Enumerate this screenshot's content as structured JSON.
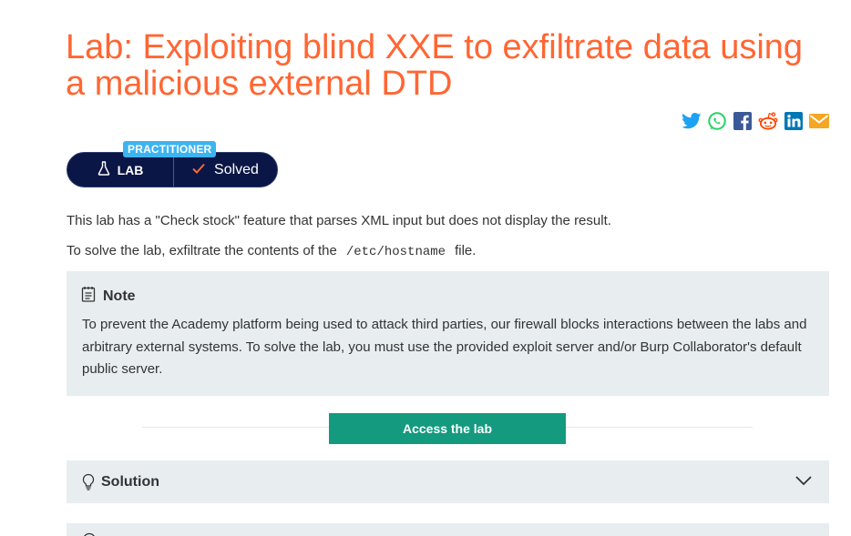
{
  "header": {
    "title": "Lab: Exploiting blind XXE to exfiltrate data using a malicious external DTD"
  },
  "share": {
    "icons": [
      "twitter-icon",
      "whatsapp-icon",
      "facebook-icon",
      "reddit-icon",
      "linkedin-icon",
      "email-icon"
    ],
    "colors": {
      "twitter": "#1da1f2",
      "whatsapp": "#25d366",
      "facebook": "#3b5998",
      "reddit": "#ff4500",
      "linkedin": "#0077b5",
      "email": "#f5a623"
    }
  },
  "badge": {
    "level": "PRACTITIONER",
    "lab_label": "LAB",
    "status": "Solved"
  },
  "description": {
    "line1": "This lab has a \"Check stock\" feature that parses XML input but does not display the result.",
    "line2_prefix": "To solve the lab, exfiltrate the contents of the",
    "line2_code": "/etc/hostname",
    "line2_suffix": "file."
  },
  "note": {
    "heading": "Note",
    "body": "To prevent the Academy platform being used to attack third parties, our firewall blocks interactions between the labs and arbitrary external systems. To solve the lab, you must use the provided exploit server and/or Burp Collaborator's default public server."
  },
  "access": {
    "button_label": "Access the lab"
  },
  "solution": {
    "label": "Solution"
  },
  "colors": {
    "accent": "#ff6633",
    "badge_bg": "#0a1645",
    "level_bg": "#3cb4f0",
    "button_bg": "#149a7e",
    "panel_bg": "#e8edf0"
  }
}
